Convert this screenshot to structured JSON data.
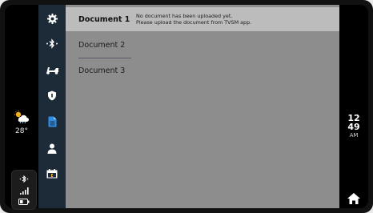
{
  "weather": {
    "temperature": "28°",
    "icon": "cloudy-rain-icon"
  },
  "status": {
    "bluetooth_icon": "bluetooth-icon",
    "signal_icon": "signal-icon",
    "battery_icon": "battery-icon"
  },
  "nav": {
    "items": [
      {
        "name": "settings",
        "icon": "gear-icon",
        "active": false
      },
      {
        "name": "bluetooth",
        "icon": "bluetooth-icon",
        "active": false
      },
      {
        "name": "vehicle",
        "icon": "scooter-icon",
        "active": false
      },
      {
        "name": "security",
        "icon": "shield-icon",
        "active": false
      },
      {
        "name": "documents",
        "icon": "document-icon",
        "active": true
      },
      {
        "name": "profile",
        "icon": "user-icon",
        "active": false
      },
      {
        "name": "service",
        "icon": "calendar-service-icon",
        "active": false
      }
    ],
    "active_color": "#2f8de4"
  },
  "documents": {
    "items": [
      {
        "label": "Document 1",
        "selected": true
      },
      {
        "label": "Document 2",
        "selected": false
      },
      {
        "label": "Document 3",
        "selected": false
      }
    ],
    "message_line1": "No document has been uploaded yet.",
    "message_line2": "Please upload the document from TVSM app."
  },
  "clock": {
    "hour": "12",
    "minute": "49",
    "period": "AM"
  },
  "home": {
    "icon": "home-icon"
  }
}
